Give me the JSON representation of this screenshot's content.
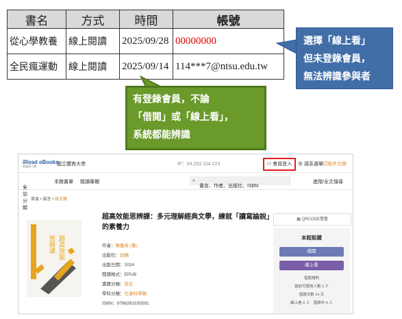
{
  "table": {
    "headers": [
      "書名",
      "方式",
      "時間",
      "帳號"
    ],
    "rows": [
      {
        "title": "從心學教養",
        "method": "線上閱讀",
        "date": "2025/09/28",
        "account": "00000000"
      },
      {
        "title": "全民瘋運動",
        "method": "線上閱讀",
        "date": "2025/09/14",
        "account": "114***7@ntsu.edu.tw"
      }
    ]
  },
  "callouts": {
    "blue": [
      "選擇「線上看」",
      "但未登錄會員，",
      "無法辨識參與者"
    ],
    "green": [
      "有登錄會員，不論",
      "「借閱」或「線上看」，",
      "系統都能辨識"
    ]
  },
  "colors": {
    "account_red": "#e00000",
    "callout_blue": "#426ea8",
    "callout_green": "#6a9a2a",
    "highlight": "#e31b1b"
  },
  "site": {
    "logo": "iRead eBooks",
    "logo_sub": "華藝電子書",
    "university": "國立體育大學",
    "ip": "IP：54.253.104.223",
    "login": "會員登入",
    "lang": "語系選單",
    "switch": "切換外文館",
    "nav": {
      "all": "全站分類",
      "new": "本館書單",
      "topics": "閱讀專欄",
      "advanced": "進階/全文搜尋"
    },
    "search_placeholder": "書名、作者、出版社、ISBN",
    "breadcrumb": {
      "home": "首頁",
      "lang": "語言",
      "current": "語言類"
    },
    "book": {
      "title": "超高效能思辨課：多元理解經典文學，練就「讀寫論說」的素養力",
      "cover_text": "超高效能 思辨課",
      "meta": [
        {
          "k": "作者：",
          "v": "陳嘉英 (著)"
        },
        {
          "k": "出版社：",
          "v": "幼獅"
        },
        {
          "k": "出版日期：",
          "v": "2024",
          "plain": true
        },
        {
          "k": "閱讀格式：",
          "v": "EPUB",
          "plain": true
        },
        {
          "k": "書籍分類：",
          "v": "語言"
        },
        {
          "k": "學科分類：",
          "v": "社會科學類"
        },
        {
          "k": "ISBN：",
          "v": "9786263105591",
          "plain": true
        }
      ]
    },
    "qr": "QRCODE借書",
    "panel": {
      "title": "本館館藏",
      "borrow": "借閱",
      "online": "線上看",
      "rules": "借閱規則",
      "line1": "當前可使用人數 2 人",
      "line2": "借閱天數 14 天",
      "line3": "線上看 0 人　借閱中 0 人"
    }
  }
}
